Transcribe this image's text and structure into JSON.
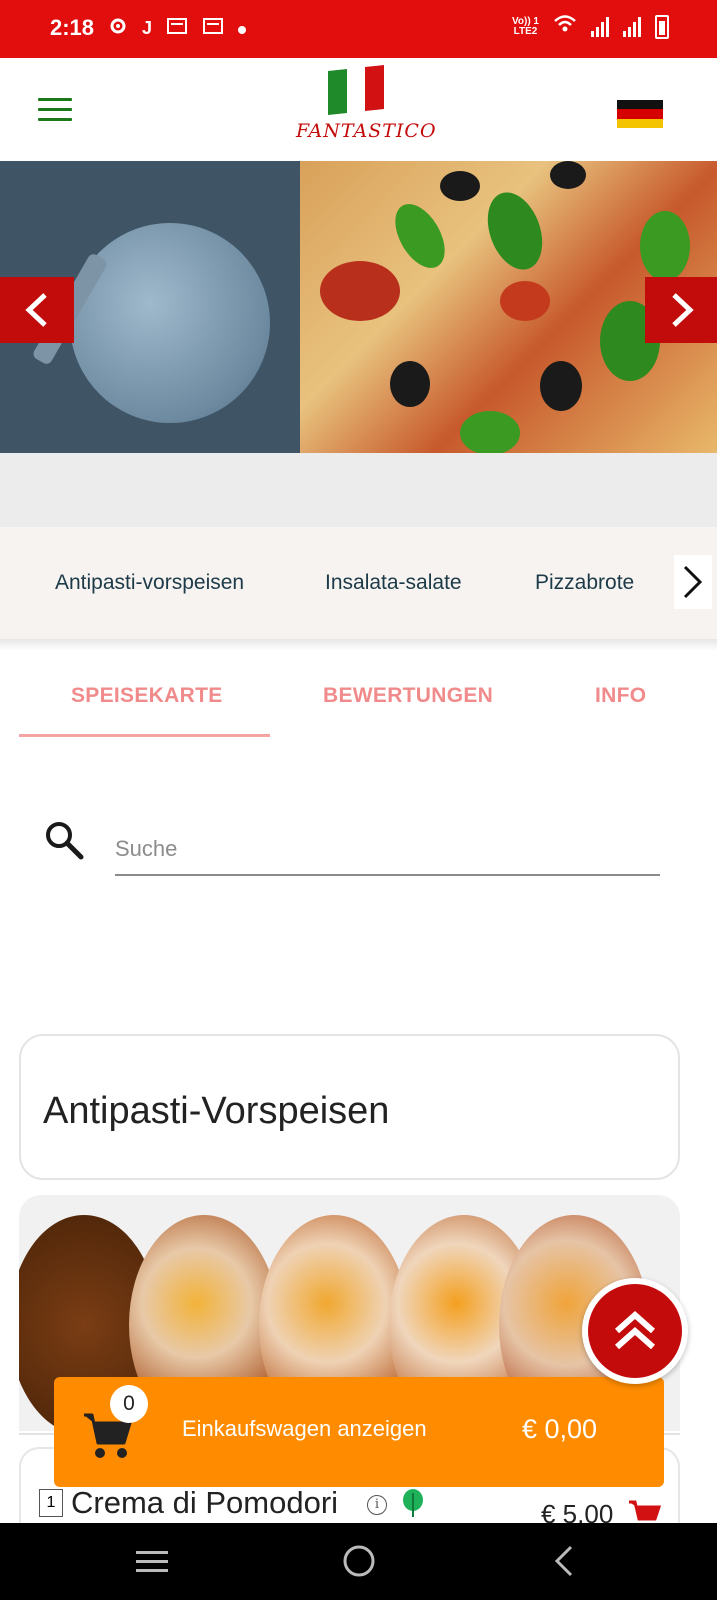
{
  "status_bar": {
    "time": "2:18",
    "network_label_top": "Vo)) 1",
    "network_label_bottom": "LTE2",
    "icons": [
      "settings-gear-icon",
      "j-app-icon",
      "news-icon",
      "news-icon",
      "dot-icon",
      "volte-icon",
      "wifi-icon",
      "signal-icon",
      "signal-icon",
      "battery-charging-icon"
    ]
  },
  "header": {
    "logo_text": "FANTASTICO",
    "menu_icon": "hamburger-icon",
    "language_flag": "germany-flag"
  },
  "hero": {
    "prev_icon": "chevron-left-icon",
    "next_icon": "chevron-right-icon"
  },
  "categories": {
    "items": [
      "Antipasti-vorspeisen",
      "Insalata-salate",
      "Pizzabrote"
    ],
    "next_icon": "chevron-right-icon"
  },
  "tabs": {
    "items": [
      "SPEISEKARTE",
      "BEWERTUNGEN",
      "INFO"
    ],
    "active": "SPEISEKARTE"
  },
  "search": {
    "placeholder": "Suche",
    "value": ""
  },
  "section": {
    "title": "Antipasti-Vorspeisen"
  },
  "item": {
    "number": "1",
    "name": "Crema di Pomodori",
    "price": "€ 5,00"
  },
  "cart": {
    "count": "0",
    "label": "Einkaufswagen anzeigen",
    "total": "€ 0,00"
  },
  "colors": {
    "brand_red": "#c20b0b",
    "status_red": "#e20d0d",
    "cart_orange": "#ff8c00",
    "tab_pink": "#f18b8b",
    "menu_green": "#1a7a1a"
  }
}
